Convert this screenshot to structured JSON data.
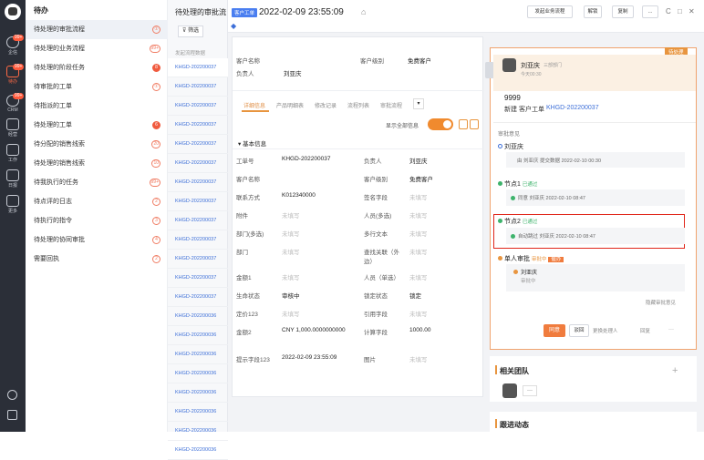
{
  "rail": {
    "items": [
      {
        "label": "",
        "badge": ""
      },
      {
        "label": "企信",
        "badge": "99+"
      },
      {
        "label": "待办",
        "badge": "99+"
      },
      {
        "label": "CRM",
        "badge": "99+"
      },
      {
        "label": "经营",
        "badge": ""
      },
      {
        "label": "工作",
        "badge": ""
      },
      {
        "label": "日报",
        "badge": ""
      },
      {
        "label": "更多",
        "badge": ""
      }
    ]
  },
  "menu": {
    "title": "待办",
    "items": [
      {
        "label": "待处理的审批流程",
        "count": "①",
        "solid": false
      },
      {
        "label": "待处理的业务流程",
        "count": "99+",
        "solid": false
      },
      {
        "label": "待处理的阶段任务",
        "count": "8",
        "solid": true
      },
      {
        "label": "待审批的工单",
        "count": "①",
        "solid": false
      },
      {
        "label": "待指派的工单",
        "count": "",
        "solid": false
      },
      {
        "label": "待处理的工单",
        "count": "6",
        "solid": true
      },
      {
        "label": "待分配的销售线索",
        "count": "20",
        "solid": false
      },
      {
        "label": "待处理的销售线索",
        "count": "10",
        "solid": false
      },
      {
        "label": "待我执行的任务",
        "count": "99+",
        "solid": false
      },
      {
        "label": "待点评的日志",
        "count": "2",
        "solid": false
      },
      {
        "label": "待执行的指令",
        "count": "3",
        "solid": false
      },
      {
        "label": "待处理的协同审批",
        "count": "4",
        "solid": false
      },
      {
        "label": "需要回执",
        "count": "2",
        "solid": false
      }
    ]
  },
  "list": {
    "title": "待处理的审批流",
    "filter_label": "筛选",
    "column_header": "发起流程数据",
    "rows": [
      "KHGD-202200037",
      "KHGD-202200037",
      "KHGD-202200037",
      "KHGD-202200037",
      "KHGD-202200037",
      "KHGD-202200037",
      "KHGD-202200037",
      "KHGD-202200037",
      "KHGD-202200037",
      "KHGD-202200037",
      "KHGD-202200037",
      "KHGD-202200037",
      "KHGD-202200037",
      "KHGD-202200036",
      "KHGD-202200036",
      "KHGD-202200036",
      "KHGD-202200036",
      "KHGD-202200036",
      "KHGD-202200036",
      "KHGD-202200036",
      "KHGD-202200036"
    ]
  },
  "detail": {
    "tag": "客户工单",
    "title": "2022-02-09 23:55:09",
    "actions": [
      "发起业务流程",
      "解锁",
      "复制",
      "...",
      "C",
      "□",
      "✕"
    ],
    "top_fields": {
      "customer_name_label": "客户名称",
      "customer_level_label": "客户级别",
      "customer_level_value": "免费客户",
      "owner_label": "负责人",
      "owner_value": "刘亚庆"
    },
    "tabs": [
      "详细信息",
      "产品明细表",
      "修改记录",
      "流程列表",
      "审批流程"
    ],
    "toggle_label": "显示全部信息",
    "section_title": "基本信息",
    "fields_left": [
      {
        "label": "工单号",
        "value": "KHGD-202200037",
        "ph": false
      },
      {
        "label": "客户名称",
        "value": "",
        "ph": false
      },
      {
        "label": "联系方式",
        "value": "K012340000",
        "ph": false
      },
      {
        "label": "附件",
        "value": "未填写",
        "ph": true
      },
      {
        "label": "部门(多选)",
        "value": "未填写",
        "ph": true
      },
      {
        "label": "部门",
        "value": "未填写",
        "ph": true
      },
      {
        "label": "金额1",
        "value": "未填写",
        "ph": true
      },
      {
        "label": "生命状态",
        "value": "审核中",
        "ph": false
      },
      {
        "label": "定价123",
        "value": "未填写",
        "ph": true
      },
      {
        "label": "金额2",
        "value": "CNY 1,000.0000000000",
        "ph": false
      },
      {
        "label": "提示字段123",
        "value": "2022-02-09 23:55:09",
        "ph": false
      }
    ],
    "fields_right": [
      {
        "label": "负责人",
        "value": "刘亚庆",
        "ph": false
      },
      {
        "label": "客户级别",
        "value": "免费客户",
        "ph": false
      },
      {
        "label": "签名字段",
        "value": "未填写",
        "ph": true
      },
      {
        "label": "人员(多选)",
        "value": "未填写",
        "ph": true
      },
      {
        "label": "多行文本",
        "value": "未填写",
        "ph": true
      },
      {
        "label": "查找关联（外边）",
        "value": "未填写",
        "ph": true
      },
      {
        "label": "人员（单选）",
        "value": "未填写",
        "ph": true
      },
      {
        "label": "锁定状态",
        "value": "锁定",
        "ph": false
      },
      {
        "label": "引用字段",
        "value": "未填写",
        "ph": true
      },
      {
        "label": "计算字段",
        "value": "1000.00",
        "ph": false
      },
      {
        "label": "图片",
        "value": "未填写",
        "ph": true
      }
    ]
  },
  "approval": {
    "status_tag": "待处理",
    "user_name": "刘亚庆",
    "user_dept": "三部部门",
    "user_time": "今天00:30",
    "amount": "9999",
    "new_line_prefix": "新建 客户工单",
    "new_line_link": "KHGD-202200037",
    "opinion_title": "审批意见",
    "steps": [
      {
        "name": "刘亚庆",
        "status": "",
        "detail": "由 刘亚庆 提交数据 2022-02-10 00:30"
      },
      {
        "name": "节点1",
        "status": "已通过",
        "detail": "同意 刘亚庆 2022-02-10 08:47"
      },
      {
        "name": "节点2",
        "status": "已通过",
        "detail": "自动跳过 刘亚庆 2022-02-10 08:47"
      },
      {
        "name": "单人审批",
        "status": "审批中",
        "detail": ""
      }
    ],
    "pending_tag": "催办",
    "pending_user": "刘亚庆",
    "pending_status": "审批中",
    "more_link": "隐藏审批意见",
    "btn_agree": "同意",
    "btn_reject": "驳回",
    "btn_change": "更换处理人",
    "btn_reply": "回复",
    "btn_more": "···"
  },
  "team": {
    "title": "相关团队",
    "add": "+"
  },
  "follow": {
    "title": "跟进动态"
  },
  "colors": {
    "accent": "#e8953f",
    "link": "#3d6fd8",
    "highlight": "#e0261a",
    "rail": "#2b2f38"
  }
}
